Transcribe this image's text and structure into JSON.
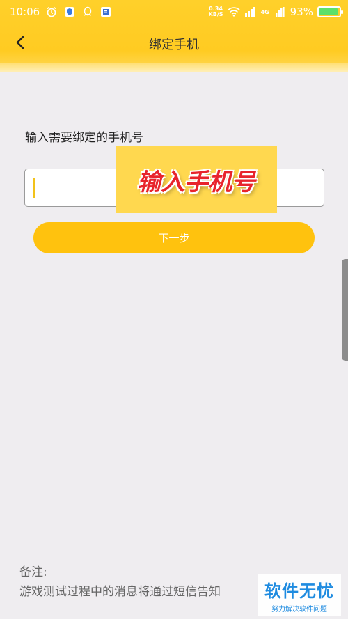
{
  "status_bar": {
    "time": "10:06",
    "net_speed_value": "0.34",
    "net_speed_unit": "KB/S",
    "network_type": "4G",
    "battery_percent": "93%",
    "battery_level": 0.93
  },
  "nav": {
    "title": "绑定手机"
  },
  "form": {
    "label": "输入需要绑定的手机号",
    "phone_value": "",
    "next_button": "下一步"
  },
  "overlay": {
    "text": "输入手机号"
  },
  "note": {
    "title": "备注:",
    "text": "游戏测试过程中的消息将通过短信告知"
  },
  "watermark": {
    "main": "软件无忧",
    "sub": "努力解决软件问题"
  },
  "colors": {
    "header": "#ffcb22",
    "button": "#ffc20e",
    "caret": "#f2c21a",
    "overlay_text": "#e8242c",
    "watermark": "#1e8be0"
  }
}
